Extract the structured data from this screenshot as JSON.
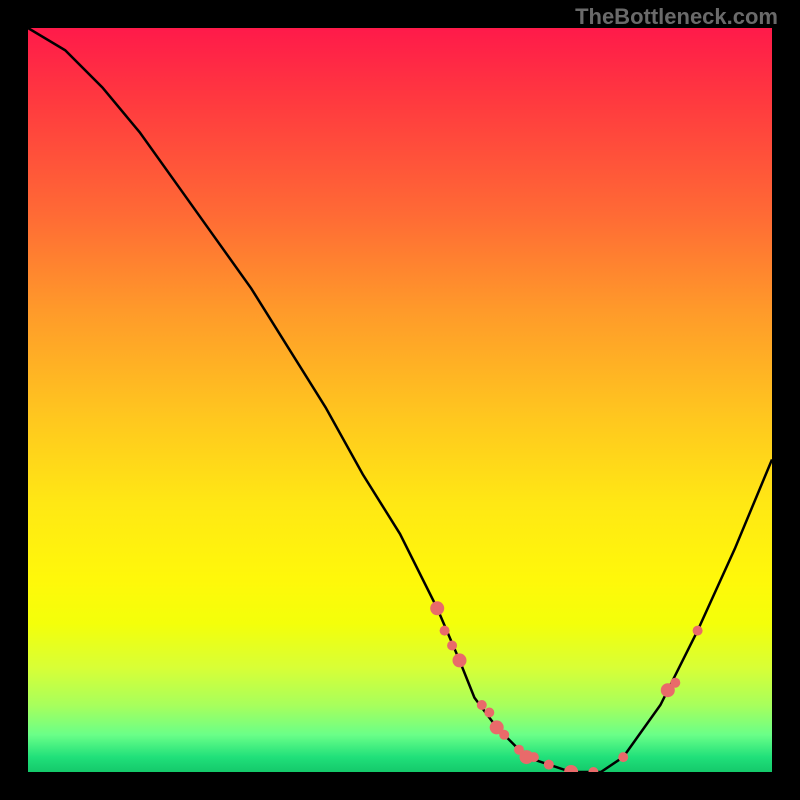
{
  "watermark": "TheBottleneck.com",
  "chart_data": {
    "type": "line",
    "title": "",
    "xlabel": "",
    "ylabel": "",
    "xlim": [
      0,
      100
    ],
    "ylim": [
      0,
      100
    ],
    "series": [
      {
        "name": "curve",
        "x": [
          0,
          5,
          10,
          15,
          20,
          25,
          30,
          35,
          40,
          45,
          50,
          55,
          58,
          60,
          63,
          67,
          70,
          73,
          77,
          80,
          85,
          90,
          95,
          100
        ],
        "values": [
          100,
          97,
          92,
          86,
          79,
          72,
          65,
          57,
          49,
          40,
          32,
          22,
          15,
          10,
          6,
          2,
          1,
          0,
          0,
          2,
          9,
          19,
          30,
          42
        ]
      }
    ],
    "highlight_points": {
      "name": "markers",
      "x": [
        55,
        56,
        57,
        58,
        61,
        62,
        63,
        64,
        66,
        67,
        68,
        70,
        73,
        76,
        80,
        86,
        87,
        90
      ],
      "values": [
        22,
        19,
        17,
        15,
        9,
        8,
        6,
        5,
        3,
        2,
        2,
        1,
        0,
        0,
        2,
        11,
        12,
        19
      ]
    }
  }
}
